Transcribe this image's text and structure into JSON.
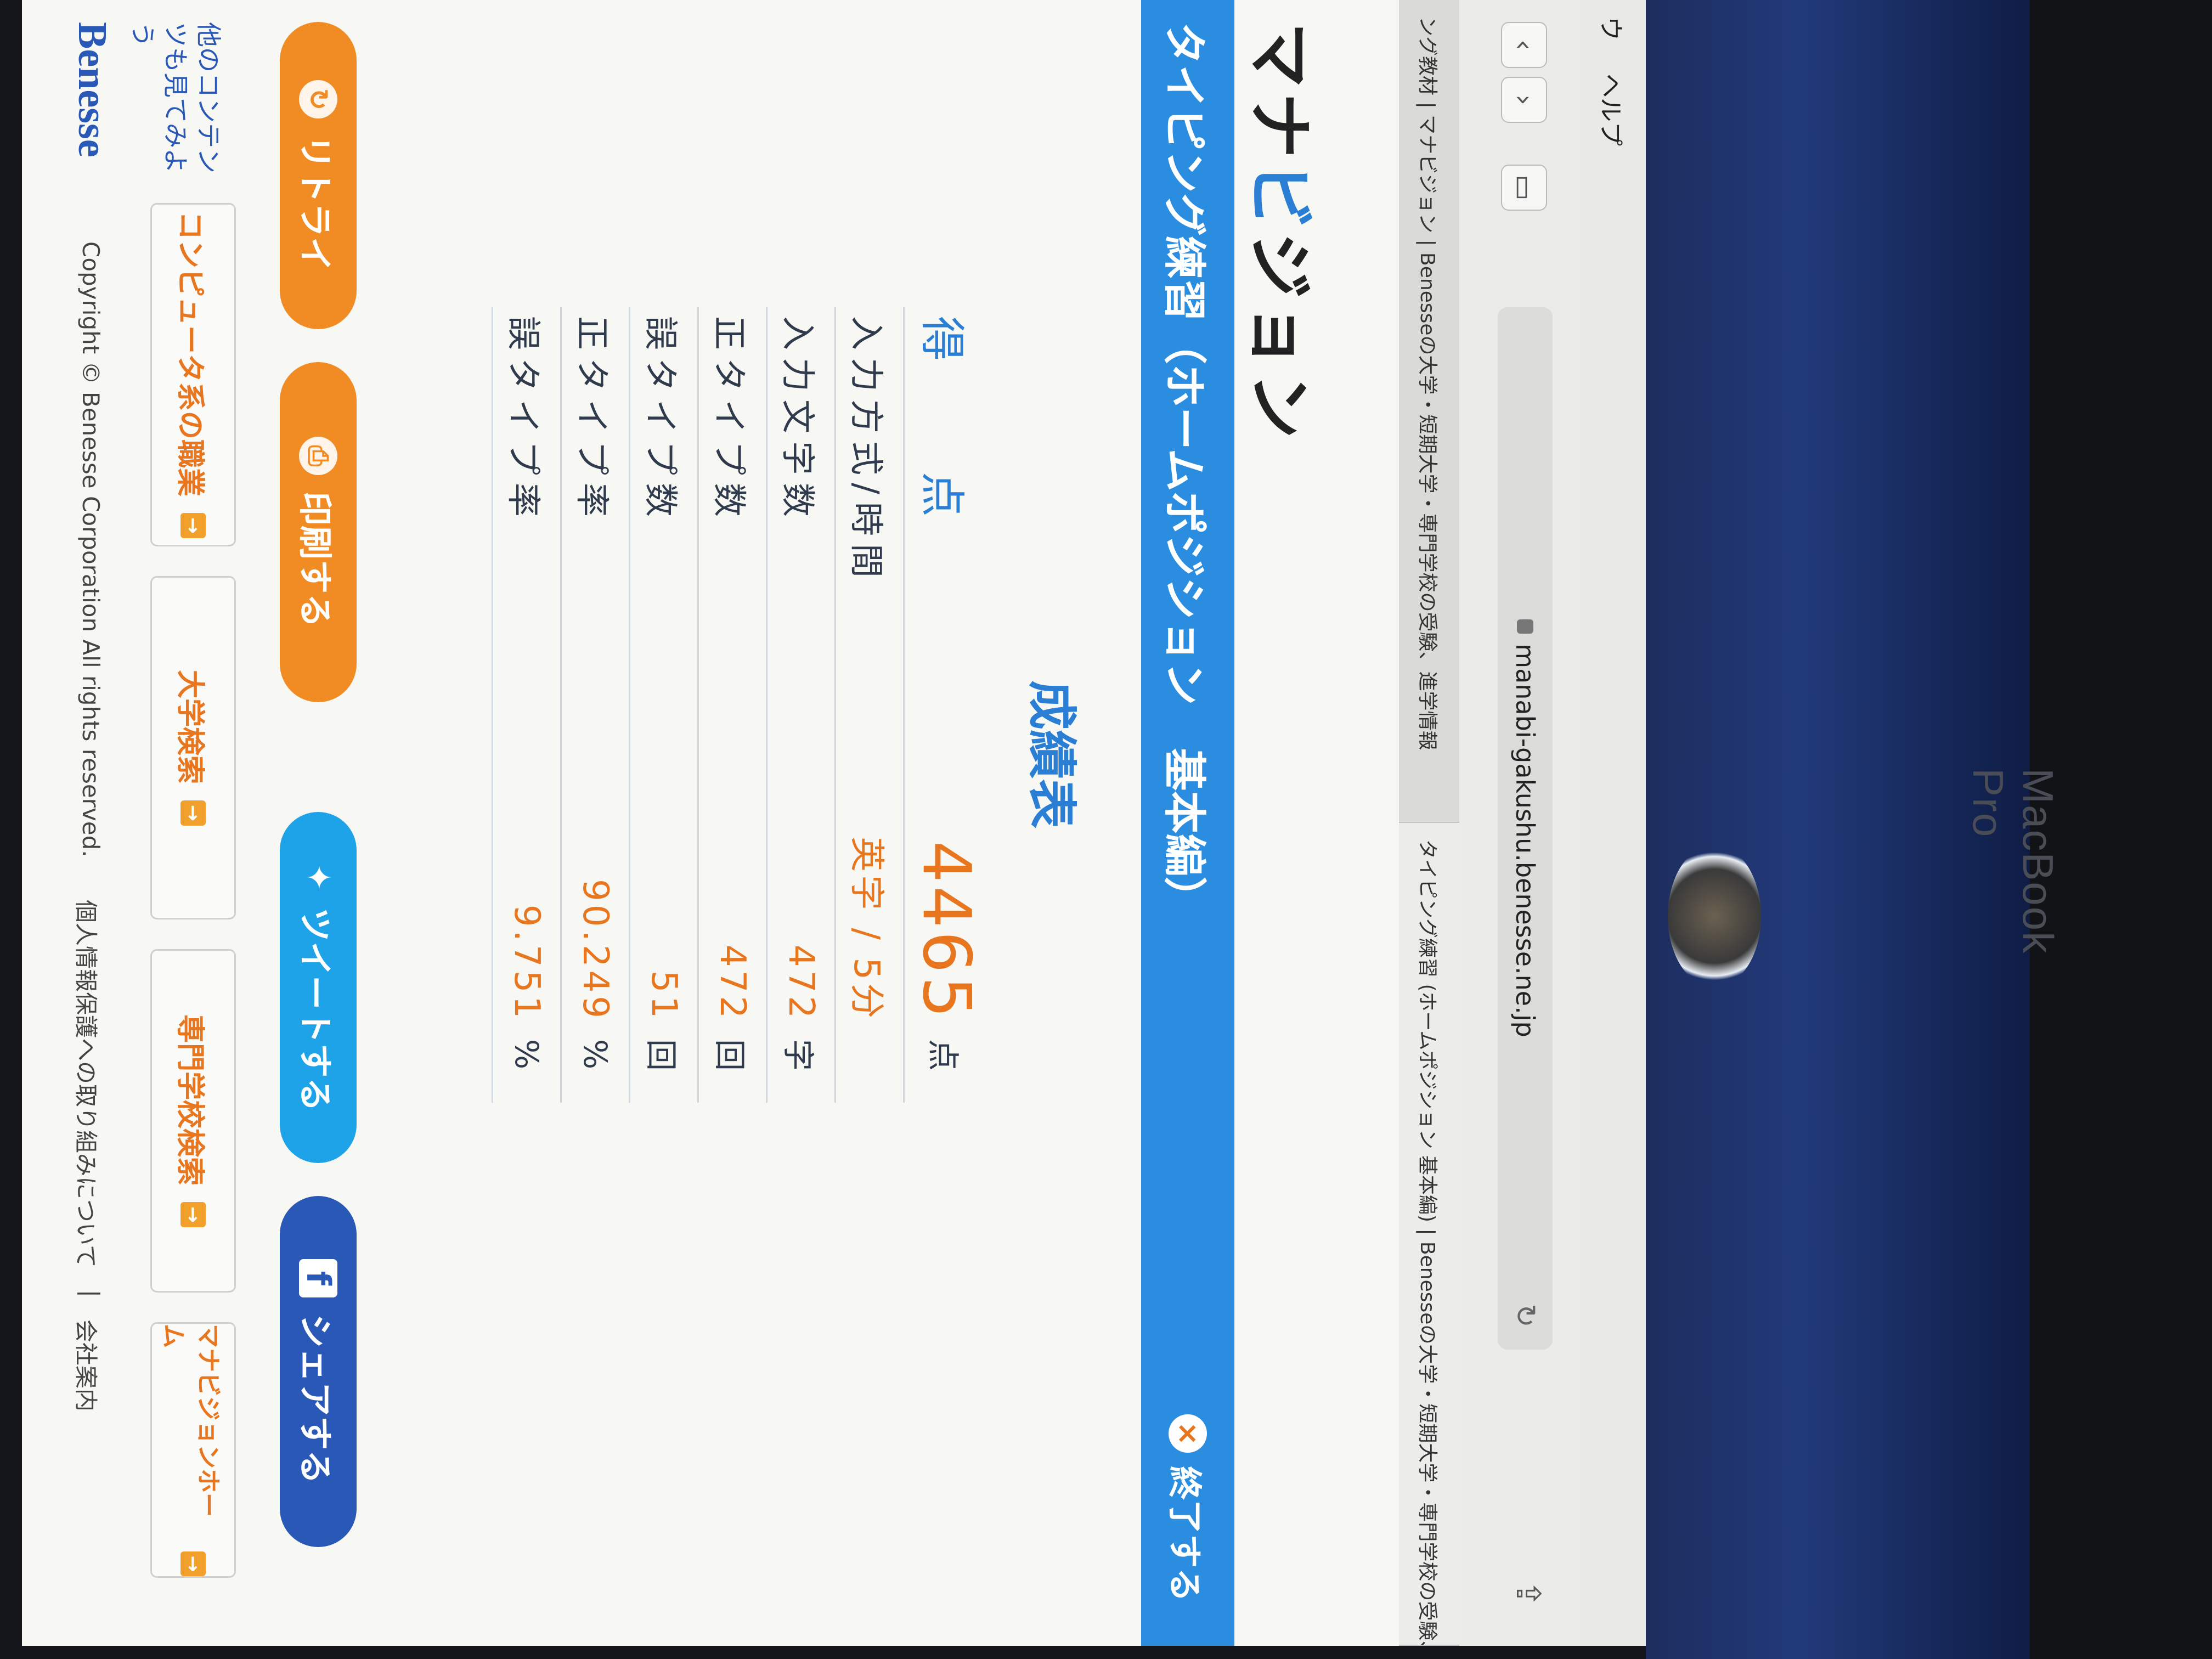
{
  "menubar": {
    "items": [
      "ウ",
      "ヘルプ"
    ]
  },
  "browser": {
    "url": "manabi-gakushu.benesse.ne.jp",
    "tabs": [
      "ング教材 | マナビジョン | Benesseの大学・短期大学・専門学校の受験、進学情報",
      "タイピング練習 (ホームポジション 基本編) | Benesseの大学・短期大学・専門学校の受験、進"
    ]
  },
  "site": {
    "title_prefix": "マナ",
    "title_accent": "ビ",
    "title_suffix": "ジョン"
  },
  "bluebar": {
    "title": "タイピング練習（ホームポジション　基本編）",
    "exit_label": "終了する"
  },
  "result": {
    "heading": "成績表",
    "rows": [
      {
        "label": "得　点",
        "value": "4465",
        "unit": "点"
      },
      {
        "label": "入力方式/時間",
        "value": "英字 / 5分",
        "unit": ""
      },
      {
        "label": "入力文字数",
        "value": "472",
        "unit": "字"
      },
      {
        "label": "正タイプ数",
        "value": "472",
        "unit": "回"
      },
      {
        "label": "誤タイプ数",
        "value": "51",
        "unit": "回"
      },
      {
        "label": "正タイプ率",
        "value": "90.249",
        "unit": "%"
      },
      {
        "label": "誤タイプ率",
        "value": "9.751",
        "unit": "%"
      }
    ]
  },
  "actions": {
    "retry": "リトライ",
    "print": "印刷する",
    "tweet": "ツイートする",
    "share": "シェアする"
  },
  "links": {
    "caption": "他のコンテンツも見てみよう",
    "items": [
      "コンピュータ系の職業",
      "大学検索",
      "専門学校検索",
      "マナビジョンホーム"
    ]
  },
  "footer": {
    "logo": "Benesse",
    "copyright": "Copyright © Benesse Corporation All rights reserved.",
    "links": [
      "個人情報保護への取り組みについて",
      "会社案内"
    ]
  },
  "device": {
    "label": "MacBook Pro"
  }
}
